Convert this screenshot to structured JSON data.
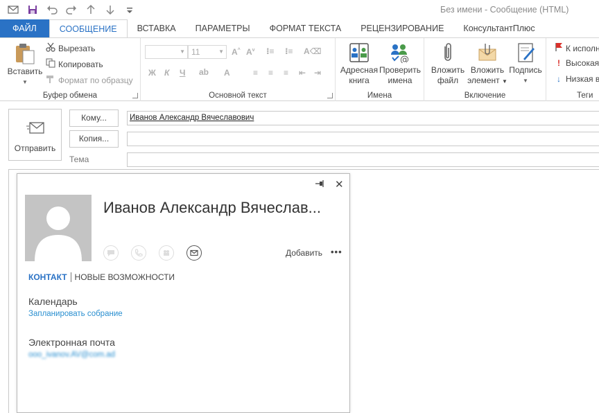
{
  "window": {
    "title": "Без имени - Сообщение (HTML)",
    "qat_icons": [
      "outlook-icon",
      "save-icon",
      "undo-icon",
      "redo-icon",
      "up-arrow-icon",
      "down-arrow-icon",
      "customize-icon"
    ]
  },
  "tabs": [
    {
      "label": "ФАЙЛ"
    },
    {
      "label": "СООБЩЕНИЕ"
    },
    {
      "label": "ВСТАВКА"
    },
    {
      "label": "ПАРАМЕТРЫ"
    },
    {
      "label": "ФОРМАТ ТЕКСТА"
    },
    {
      "label": "РЕЦЕНЗИРОВАНИЕ"
    },
    {
      "label": "КонсультантПлюс"
    }
  ],
  "ribbon": {
    "clipboard": {
      "label": "Буфер обмена",
      "paste": "Вставить",
      "cut": "Вырезать",
      "copy": "Копировать",
      "format_painter": "Формат по образцу"
    },
    "basic_text": {
      "label": "Основной текст",
      "font_size": "11",
      "bold": "Ж",
      "italic": "К",
      "underline": "Ч"
    },
    "names": {
      "label": "Имена",
      "address_book_1": "Адресная",
      "address_book_2": "книга",
      "check_names_1": "Проверить",
      "check_names_2": "имена"
    },
    "include": {
      "label": "Включение",
      "attach_file_1": "Вложить",
      "attach_file_2": "файл",
      "attach_item_1": "Вложить",
      "attach_item_2": "элемент",
      "signature": "Подпись"
    },
    "tags": {
      "label": "Теги",
      "followup": "К исполн",
      "high": "Высокая",
      "low": "Низкая в"
    }
  },
  "compose": {
    "send": "Отправить",
    "to_button": "Кому...",
    "cc_button": "Копия...",
    "subject_label": "Тема",
    "to_value": "Иванов Александр Вячеславович",
    "cc_value": "",
    "subject_value": ""
  },
  "contact_card": {
    "name": "Иванов Александр Вячеслав...",
    "add": "Добавить",
    "more": "•••",
    "tab_contact": "КОНТАКТ",
    "tab_whatsnew": "НОВЫЕ ВОЗМОЖНОСТИ",
    "calendar_label": "Календарь",
    "schedule_link": "Запланировать собрание",
    "email_label": "Электронная почта",
    "email_value": "ооо_ivanov.AV@com.ad"
  },
  "colors": {
    "accent": "#2a72c5",
    "link": "#2a8fd0",
    "avatar_bg": "#c4c4c4"
  }
}
